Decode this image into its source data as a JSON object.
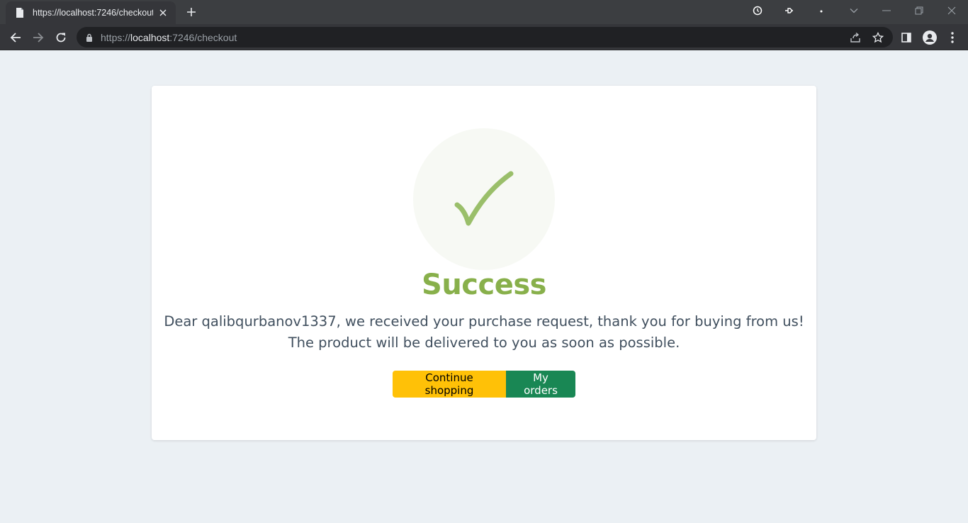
{
  "browser": {
    "tab_title": "https://localhost:7246/checkout",
    "url_scheme": "https://",
    "url_host": "localhost",
    "url_rest": ":7246/checkout"
  },
  "page": {
    "title": "Success",
    "message_line1": "Dear qalibqurbanov1337, we received your purchase request, thank you for buying from us!",
    "message_line2": "The product will be delivered to you as soon as possible.",
    "buttons": {
      "continue_label": "Continue shopping",
      "orders_label": "My orders"
    }
  },
  "colors": {
    "success_green": "#88b04b",
    "warning_yellow": "#ffc107",
    "button_green": "#198754",
    "page_bg": "#ebf0f4"
  },
  "icons": {
    "check": "checkmark-icon"
  }
}
